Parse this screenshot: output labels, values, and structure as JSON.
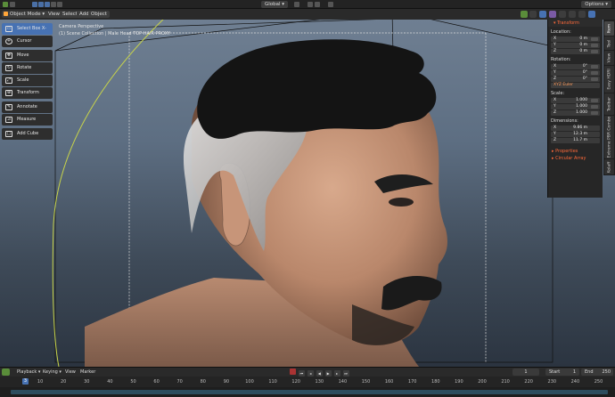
{
  "topbar": {
    "orientation": "Global",
    "options": "Options"
  },
  "viewport_header": {
    "mode": "Object Mode",
    "menu": [
      "View",
      "Select",
      "Add",
      "Object"
    ]
  },
  "viewport_info": {
    "line1": "Camera Perspective",
    "line2": "(1) Scene Collection | Male Head TOP HAIR PROXY"
  },
  "tools": [
    {
      "label": "Select Box X-Ray",
      "icon": "select-box-icon",
      "active": true
    },
    {
      "label": "Cursor",
      "icon": "cursor-icon"
    },
    {
      "label": "Move",
      "icon": "move-icon"
    },
    {
      "label": "Rotate",
      "icon": "rotate-icon"
    },
    {
      "label": "Scale",
      "icon": "scale-icon"
    },
    {
      "label": "Transform",
      "icon": "transform-icon"
    },
    {
      "label": "Annotate",
      "icon": "annotate-icon"
    },
    {
      "label": "Measure",
      "icon": "measure-icon"
    },
    {
      "label": "Add Cube",
      "icon": "add-cube-icon"
    }
  ],
  "npanel": {
    "header": "Transform",
    "location_label": "Location:",
    "location": [
      {
        "axis": "X",
        "value": "0 m"
      },
      {
        "axis": "Y",
        "value": "0 m"
      },
      {
        "axis": "Z",
        "value": "0 m"
      }
    ],
    "rotation_label": "Rotation:",
    "rotation": [
      {
        "axis": "X",
        "value": "0°"
      },
      {
        "axis": "Y",
        "value": "0°"
      },
      {
        "axis": "Z",
        "value": "0°"
      }
    ],
    "rotation_mode": "XYZ Euler",
    "scale_label": "Scale:",
    "scale": [
      {
        "axis": "X",
        "value": "1.000"
      },
      {
        "axis": "Y",
        "value": "1.000"
      },
      {
        "axis": "Z",
        "value": "1.000"
      }
    ],
    "dimensions_label": "Dimensions:",
    "dimensions": [
      {
        "axis": "X",
        "value": "9.86 m"
      },
      {
        "axis": "Y",
        "value": "12.3 m"
      },
      {
        "axis": "Z",
        "value": "11.7 m"
      }
    ],
    "sub1": "Properties",
    "sub2": "Circular Array"
  },
  "ntabs": [
    "Item",
    "Tool",
    "View",
    "Easy HDRI",
    "Toolbar",
    "Extreme PBR Combo",
    "Kolaff"
  ],
  "timeline": {
    "playback": "Playback",
    "keying": "Keying",
    "view": "View",
    "marker": "Marker",
    "current_frame": "1",
    "start_label": "Start",
    "start": "1",
    "end_label": "End",
    "end": "250",
    "playhead": "3",
    "ticks": [
      "10",
      "20",
      "30",
      "40",
      "50",
      "60",
      "70",
      "80",
      "90",
      "100",
      "110",
      "120",
      "130",
      "140",
      "150",
      "160",
      "170",
      "180",
      "190",
      "200",
      "210",
      "220",
      "230",
      "240",
      "250"
    ]
  },
  "colors": {
    "accent": "#4772b3",
    "orange": "#ff6a3a",
    "viewport_top": "#6f7f92",
    "viewport_bottom": "#2b3440"
  }
}
